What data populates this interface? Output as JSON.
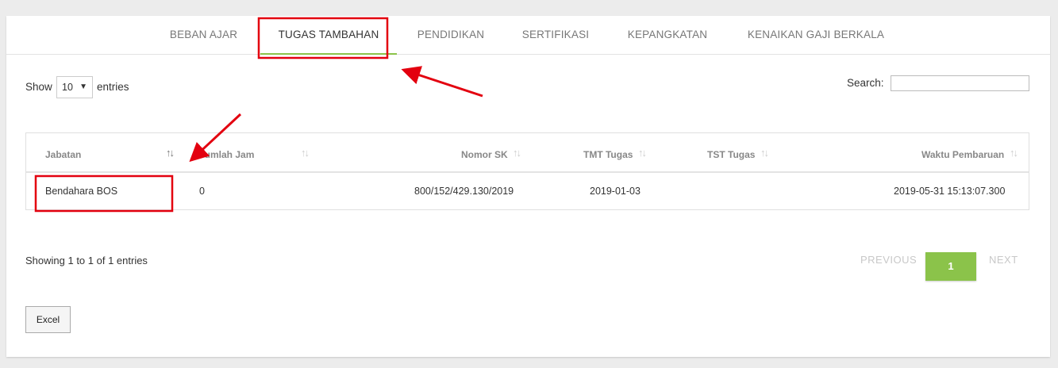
{
  "tabs": [
    {
      "label": "BEBAN AJAR",
      "active": false
    },
    {
      "label": "TUGAS TAMBAHAN",
      "active": true
    },
    {
      "label": "PENDIDIKAN",
      "active": false
    },
    {
      "label": "SERTIFIKASI",
      "active": false
    },
    {
      "label": "KEPANGKATAN",
      "active": false
    },
    {
      "label": "KENAIKAN GAJI BERKALA",
      "active": false
    }
  ],
  "length_control": {
    "show_label": "Show",
    "selected": "10",
    "entries_label": "entries"
  },
  "search": {
    "label": "Search:",
    "value": ""
  },
  "table": {
    "columns": [
      "Jabatan",
      "Jumlah Jam",
      "Nomor SK",
      "TMT Tugas",
      "TST Tugas",
      "Waktu Pembaruan"
    ],
    "rows": [
      [
        "Bendahara BOS",
        "0",
        "800/152/429.130/2019",
        "2019-01-03",
        "",
        "2019-05-31 15:13:07.300"
      ]
    ]
  },
  "info": "Showing 1 to 1 of 1 entries",
  "pagination": {
    "previous": "PREVIOUS",
    "current": "1",
    "next": "NEXT"
  },
  "buttons": {
    "excel": "Excel"
  },
  "colors": {
    "accent": "#8bc34a",
    "annotation": "#e3000f"
  }
}
